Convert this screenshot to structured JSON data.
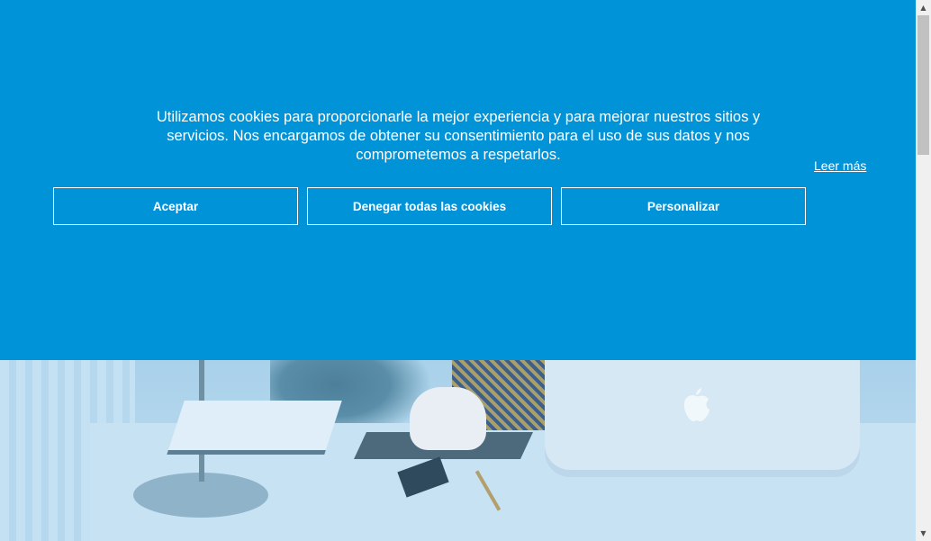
{
  "cookie_banner": {
    "message": "Utilizamos cookies para proporcionarle la mejor experiencia y para mejorar nuestros sitios y servicios. Nos encargamos de obtener su consentimiento para el uso de sus datos y nos comprometemos a respetarlos.",
    "read_more": "Leer más",
    "buttons": {
      "accept": "Aceptar",
      "deny": "Denegar todas las cookies",
      "customize": "Personalizar"
    },
    "background_color": "#0093d8",
    "text_color": "#ffffff"
  },
  "hero": {
    "logo_glyph": ""
  },
  "scrollbar": {
    "up_arrow": "▲",
    "down_arrow": "▼"
  }
}
